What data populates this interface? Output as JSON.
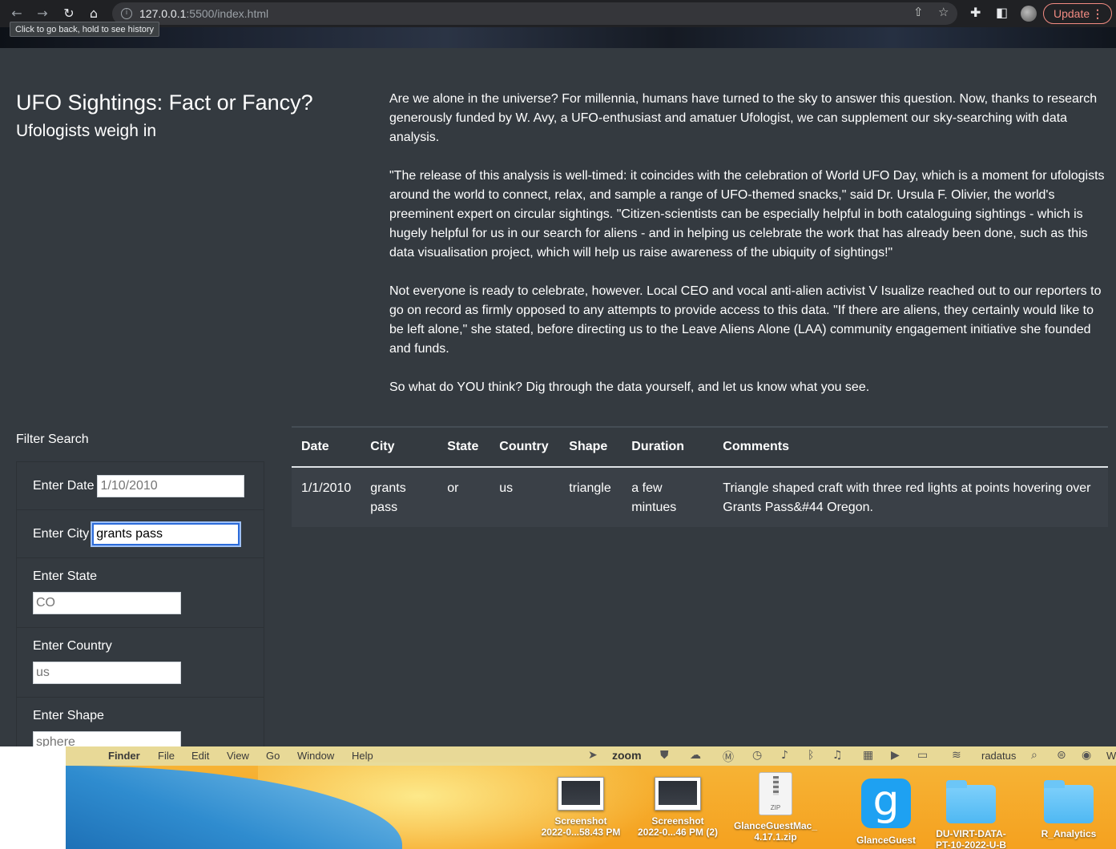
{
  "browser": {
    "back_icon": "arrow-left-icon",
    "forward_icon": "arrow-right-icon",
    "reload_icon": "reload-icon",
    "home_icon": "home-icon",
    "url_host": "127.0.0.1",
    "url_rest": ":5500/index.html",
    "tooltip": "Click to go back, hold to see history",
    "update_label": "Update"
  },
  "header": {
    "title": "UFO Sightings: Fact or Fancy?",
    "subtitle": "Ufologists weigh in"
  },
  "article": {
    "paragraphs": [
      "Are we alone in the universe? For millennia, humans have turned to the sky to answer this question. Now, thanks to research generously funded by W. Avy, a UFO-enthusiast and amatuer Ufologist, we can supplement our sky-searching with data analysis.",
      "\"The release of this analysis is well-timed: it coincides with the celebration of World UFO Day, which is a moment for ufologists around the world to connect, relax, and sample a range of UFO-themed snacks,\" said Dr. Ursula F. Olivier, the world's preeminent expert on circular sightings. \"Citizen-scientists can be especially helpful in both cataloguing sightings - which is hugely helpful for us in our search for aliens - and in helping us celebrate the work that has already been done, such as this data visualisation project, which will help us raise awareness of the ubiquity of sightings!\"",
      "Not everyone is ready to celebrate, however. Local CEO and vocal anti-alien activist V Isualize reached out to our reporters to go on record as firmly opposed to any attempts to provide access to this data. \"If there are aliens, they certainly would like to be left alone,\" she stated, before directing us to the Leave Aliens Alone (LAA) community engagement initiative she founded and funds.",
      "So what do YOU think? Dig through the data yourself, and let us know what you see."
    ]
  },
  "filters": {
    "title": "Filter Search",
    "date": {
      "label": "Enter Date",
      "placeholder": "1/10/2010"
    },
    "city": {
      "label": "Enter City",
      "value": "grants pass"
    },
    "state": {
      "label": "Enter State",
      "placeholder": "CO"
    },
    "country": {
      "label": "Enter Country",
      "placeholder": "us"
    },
    "shape": {
      "label": "Enter Shape",
      "placeholder": "sphere"
    }
  },
  "table": {
    "headers": [
      "Date",
      "City",
      "State",
      "Country",
      "Shape",
      "Duration",
      "Comments"
    ],
    "rows": [
      [
        "1/1/2010",
        "grants pass",
        "or",
        "us",
        "triangle",
        "a few mintues",
        "Triangle shaped craft with three red lights at points hovering over Grants Pass&#44 Oregon."
      ]
    ]
  },
  "menubar": {
    "apple_icon": "apple-icon",
    "items": [
      "Finder",
      "File",
      "Edit",
      "View",
      "Go",
      "Window",
      "Help"
    ],
    "zoom": "zoom",
    "user": "radatus",
    "cut": "W"
  },
  "desktop": {
    "items": [
      {
        "label": "Screenshot",
        "sub": "2022-0...58.43 PM",
        "icon": "screenshot-icon"
      },
      {
        "label": "Screenshot",
        "sub": "2022-0...46 PM (2)",
        "icon": "screenshot-icon"
      },
      {
        "label": "GlanceGuestMac_",
        "sub": "4.17.1.zip",
        "icon": "zip-icon"
      },
      {
        "label": "",
        "sub": "GlanceGuest",
        "icon": "glance-app-icon"
      },
      {
        "label": "DU-VIRT-DATA-",
        "sub": "PT-10-2022-U-B",
        "icon": "folder-icon"
      },
      {
        "label": "R_Analytics",
        "sub": "",
        "icon": "folder-icon"
      }
    ],
    "zip_badge": "ZIP",
    "glance_letter": "g"
  },
  "colors": {
    "page_bg": "#343a40",
    "focus_ring": "#2c6bd9",
    "update_accent": "#f28b82"
  }
}
